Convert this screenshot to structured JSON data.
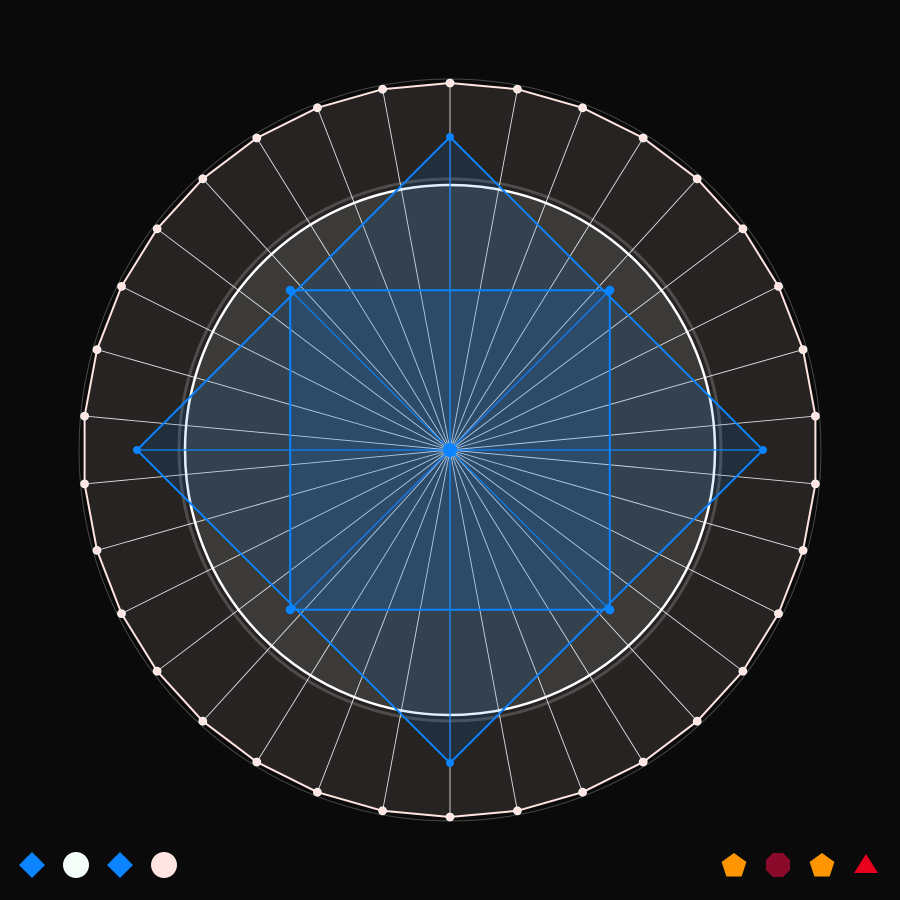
{
  "colors": {
    "background": "#0a0a0a",
    "ring_fill": "#262322",
    "ring_outline": "#ffe4e1",
    "inner_disc_fill": "#3b3a38",
    "inner_circle_stroke": "#ffffff",
    "spoke": "#ffffff",
    "accent_blue": "#0a84ff",
    "orange": "#ff9500",
    "crimson": "#8b0a2b",
    "red": "#e8001c",
    "mint_white": "#f5fffa",
    "misty_rose": "#ffe4e1"
  },
  "diagram": {
    "outer_polygon": {
      "vertex_count": 34,
      "color": "misty_rose"
    },
    "inner_circle": {
      "spokes": 34
    },
    "diamond": {
      "vertices": 4,
      "color": "accent_blue"
    },
    "square": {
      "vertices": 4,
      "color": "accent_blue"
    },
    "center_node": {
      "color": "accent_blue"
    }
  },
  "legend": {
    "left": [
      {
        "shape": "diamond",
        "color": "#0a84ff",
        "icon": "blue-diamond-icon"
      },
      {
        "shape": "circle",
        "color": "#f5fffa",
        "icon": "white-circle-icon"
      },
      {
        "shape": "diamond",
        "color": "#0a84ff",
        "icon": "blue-diamond-icon"
      },
      {
        "shape": "circle",
        "color": "#ffe4e1",
        "icon": "pink-circle-icon"
      }
    ],
    "right": [
      {
        "shape": "pentagon",
        "color": "#ff9500",
        "icon": "orange-pentagon-icon"
      },
      {
        "shape": "octagon",
        "color": "#8b0a2b",
        "icon": "crimson-octagon-icon"
      },
      {
        "shape": "pentagon",
        "color": "#ff9500",
        "icon": "orange-pentagon-icon"
      },
      {
        "shape": "triangle",
        "color": "#e8001c",
        "icon": "red-triangle-icon"
      }
    ]
  }
}
